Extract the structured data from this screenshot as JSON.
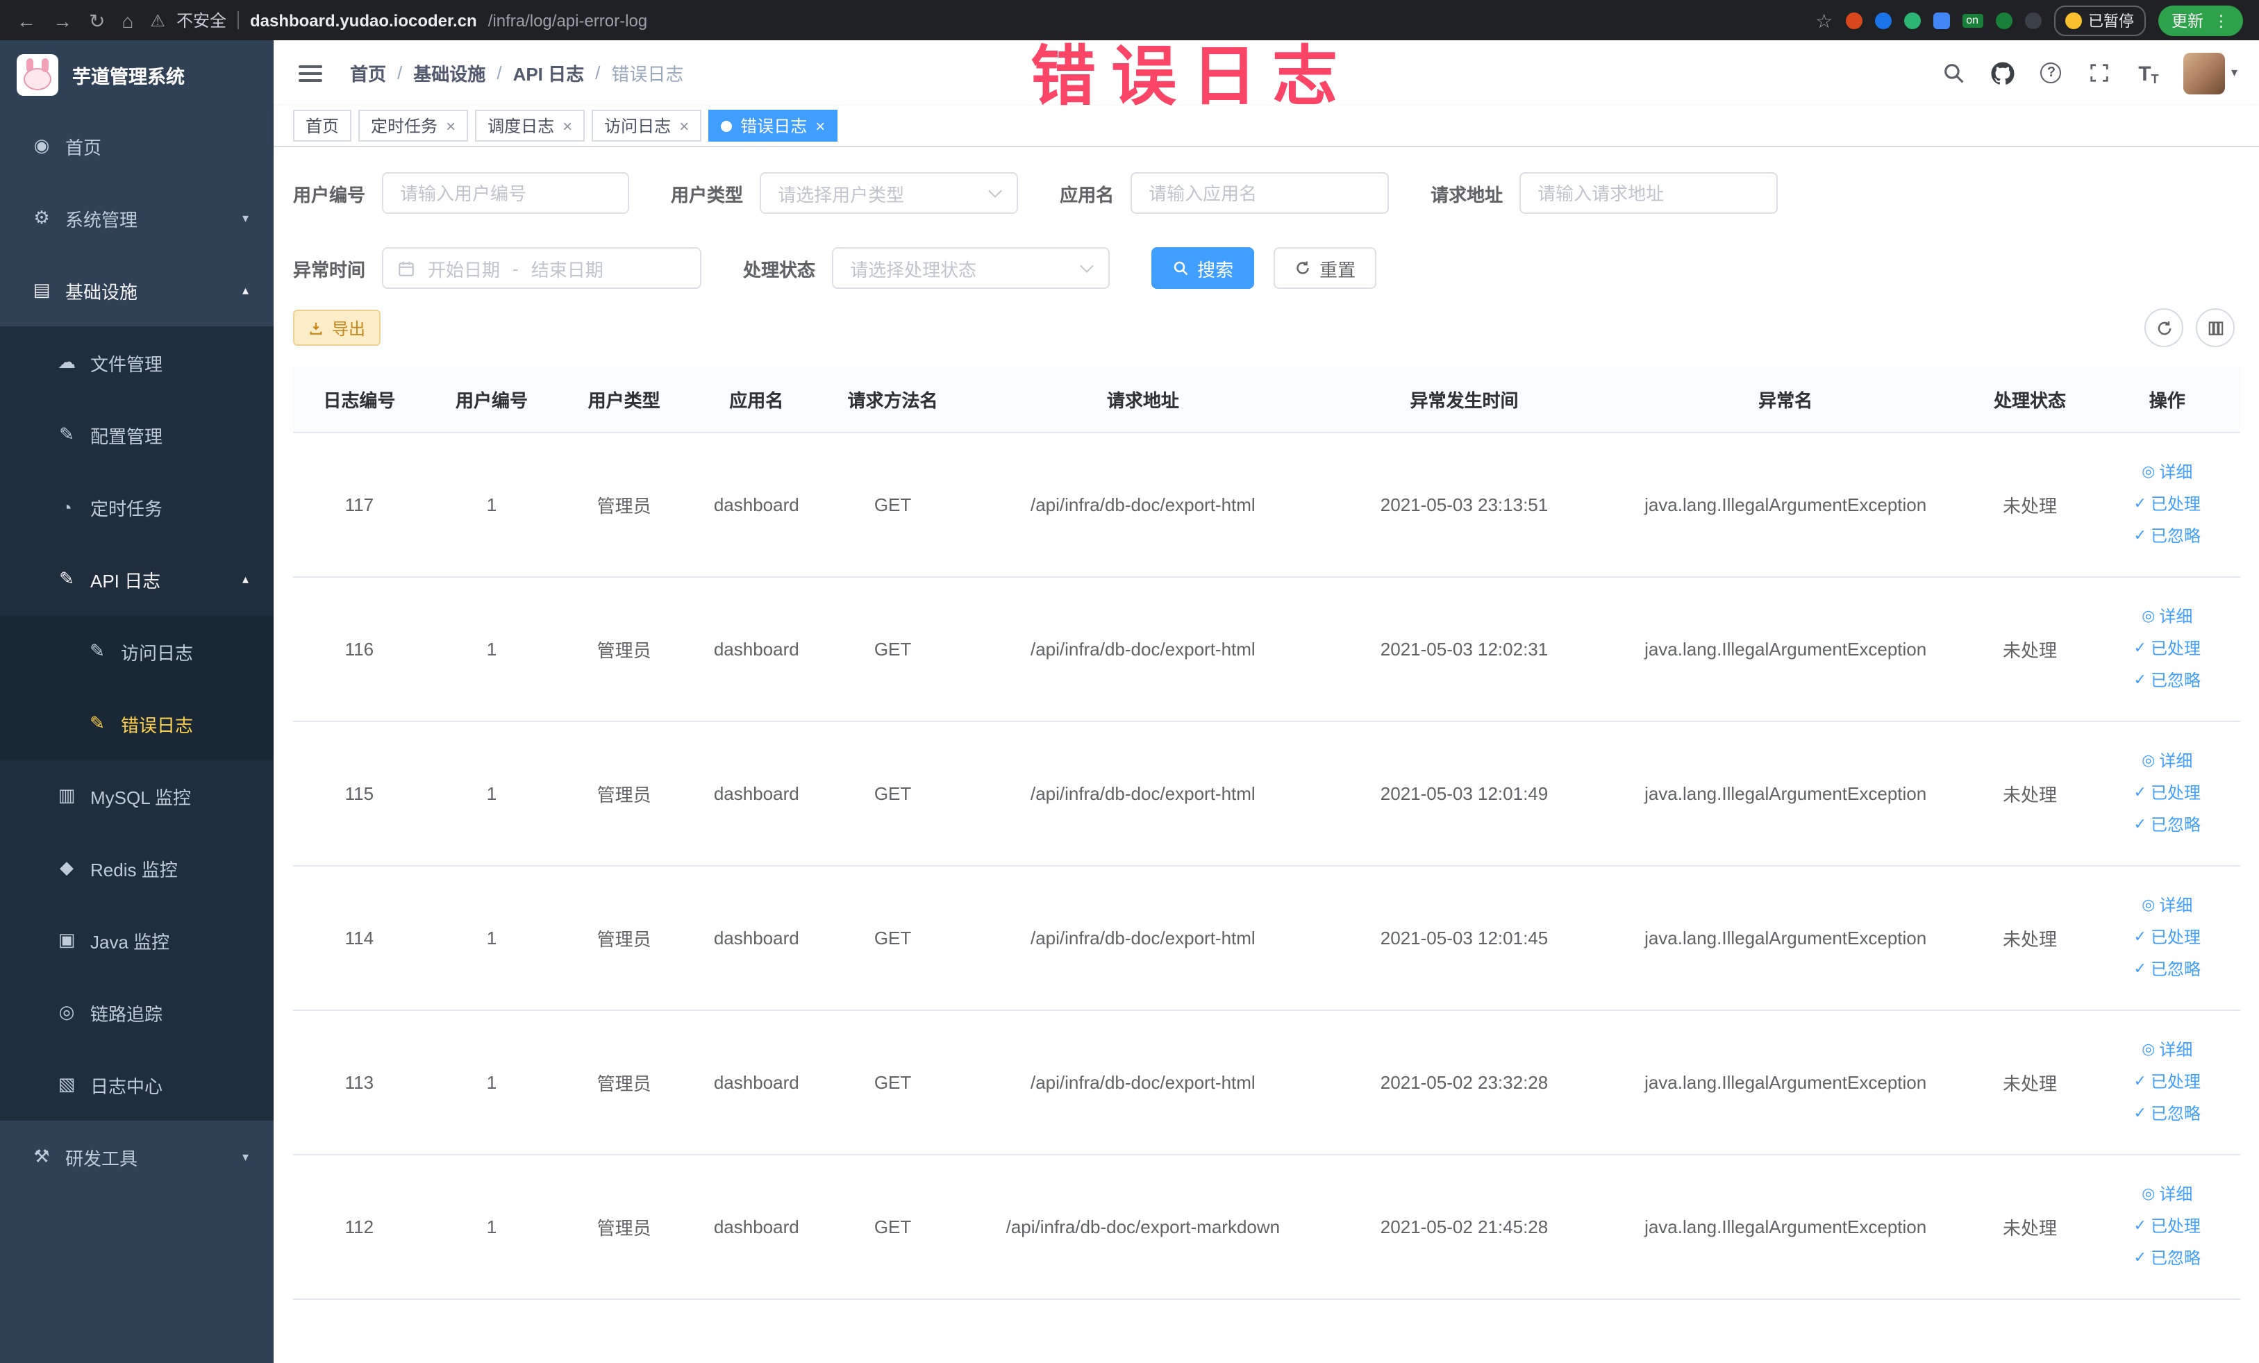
{
  "browser": {
    "security_label": "不安全",
    "url_domain": "dashboard.yudao.iocoder.cn",
    "url_path": "/infra/log/api-error-log",
    "on_badge": "on",
    "paused_badge": "已暂停",
    "update_button": "更新"
  },
  "annotation": {
    "text": "错误日志",
    "color": "#fb2c52"
  },
  "sidebar": {
    "title": "芋道管理系统",
    "items": {
      "home": "首页",
      "system": "系统管理",
      "infra": "基础设施",
      "file": "文件管理",
      "config": "配置管理",
      "job": "定时任务",
      "apilog": "API 日志",
      "accesslog": "访问日志",
      "errorlog": "错误日志",
      "mysql": "MySQL 监控",
      "redis": "Redis 监控",
      "java": "Java 监控",
      "trace": "链路追踪",
      "logcenter": "日志中心",
      "devtools": "研发工具"
    }
  },
  "breadcrumb": {
    "separator": "/",
    "items": [
      "首页",
      "基础设施",
      "API 日志",
      "错误日志"
    ]
  },
  "tags": [
    {
      "label": "首页",
      "closable": false,
      "active": false
    },
    {
      "label": "定时任务",
      "closable": true,
      "active": false
    },
    {
      "label": "调度日志",
      "closable": true,
      "active": false
    },
    {
      "label": "访问日志",
      "closable": true,
      "active": false
    },
    {
      "label": "错误日志",
      "closable": true,
      "active": true
    }
  ],
  "filters": {
    "user_id": {
      "label": "用户编号",
      "placeholder": "请输入用户编号"
    },
    "user_type": {
      "label": "用户类型",
      "placeholder": "请选择用户类型"
    },
    "app_name": {
      "label": "应用名",
      "placeholder": "请输入应用名"
    },
    "request_url": {
      "label": "请求地址",
      "placeholder": "请输入请求地址"
    },
    "exception_time": {
      "label": "异常时间",
      "start_placeholder": "开始日期",
      "separator": "-",
      "end_placeholder": "结束日期"
    },
    "process_status": {
      "label": "处理状态",
      "placeholder": "请选择处理状态"
    },
    "search_button": "搜索",
    "reset_button": "重置"
  },
  "toolbar": {
    "export_button": "导出"
  },
  "table": {
    "columns": [
      "日志编号",
      "用户编号",
      "用户类型",
      "应用名",
      "请求方法名",
      "请求地址",
      "异常发生时间",
      "异常名",
      "处理状态",
      "操作"
    ],
    "actions": [
      "详细",
      "已处理",
      "已忽略"
    ],
    "rows": [
      {
        "id": "117",
        "user_id": "1",
        "user_type": "管理员",
        "app_name": "dashboard",
        "method": "GET",
        "url": "/api/infra/db-doc/export-html",
        "time": "2021-05-03 23:13:51",
        "exception": "java.lang.IllegalArgumentException",
        "status": "未处理"
      },
      {
        "id": "116",
        "user_id": "1",
        "user_type": "管理员",
        "app_name": "dashboard",
        "method": "GET",
        "url": "/api/infra/db-doc/export-html",
        "time": "2021-05-03 12:02:31",
        "exception": "java.lang.IllegalArgumentException",
        "status": "未处理"
      },
      {
        "id": "115",
        "user_id": "1",
        "user_type": "管理员",
        "app_name": "dashboard",
        "method": "GET",
        "url": "/api/infra/db-doc/export-html",
        "time": "2021-05-03 12:01:49",
        "exception": "java.lang.IllegalArgumentException",
        "status": "未处理"
      },
      {
        "id": "114",
        "user_id": "1",
        "user_type": "管理员",
        "app_name": "dashboard",
        "method": "GET",
        "url": "/api/infra/db-doc/export-html",
        "time": "2021-05-03 12:01:45",
        "exception": "java.lang.IllegalArgumentException",
        "status": "未处理"
      },
      {
        "id": "113",
        "user_id": "1",
        "user_type": "管理员",
        "app_name": "dashboard",
        "method": "GET",
        "url": "/api/infra/db-doc/export-html",
        "time": "2021-05-02 23:32:28",
        "exception": "java.lang.IllegalArgumentException",
        "status": "未处理"
      },
      {
        "id": "112",
        "user_id": "1",
        "user_type": "管理员",
        "app_name": "dashboard",
        "method": "GET",
        "url": "/api/infra/db-doc/export-markdown",
        "time": "2021-05-02 21:45:28",
        "exception": "java.lang.IllegalArgumentException",
        "status": "未处理"
      }
    ]
  },
  "icons": {
    "back": "←",
    "forward": "→",
    "reload": "↻",
    "home_chrome": "⌂",
    "warning": "⚠",
    "star": "☆",
    "kebab": "⋮",
    "close": "×",
    "question": "?",
    "caret_down": "▾",
    "chevron_down": "▾",
    "chevron_up": "▴",
    "letter_T": "T",
    "side_home": "◉",
    "side_system": "⚙",
    "side_infra": "▤",
    "side_file": "☁",
    "side_config": "✎",
    "side_job": "◔",
    "side_apilog": "✎",
    "side_accesslog": "✎",
    "side_errorlog": "✎",
    "side_mysql": "▥",
    "side_redis": "◆",
    "side_java": "▣",
    "side_trace": "◎",
    "side_logcenter": "▧",
    "side_devtools": "⚒",
    "detail": "◎",
    "check": "✓"
  }
}
